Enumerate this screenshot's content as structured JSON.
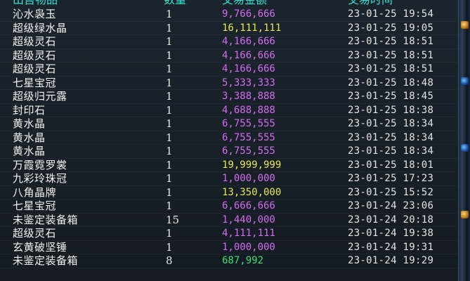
{
  "header": {
    "item": "出售物品",
    "qty": "数量",
    "amount": "交易金额",
    "time": "交易时间"
  },
  "colors": {
    "purple": "#d46cf0",
    "yellow": "#e8e84a",
    "green": "#35e07a",
    "header": "#35e0cf"
  },
  "rows": [
    {
      "item": "沁水袅玉",
      "qty": "1",
      "amount": "9,766,666",
      "color": "purple",
      "time": "23-01-25 19:54"
    },
    {
      "item": "超级绿水晶",
      "qty": "1",
      "amount": "16,111,111",
      "color": "yellow",
      "time": "23-01-25 19:05"
    },
    {
      "item": "超级灵石",
      "qty": "1",
      "amount": "4,166,666",
      "color": "purple",
      "time": "23-01-25 18:51"
    },
    {
      "item": "超级灵石",
      "qty": "1",
      "amount": "4,166,666",
      "color": "purple",
      "time": "23-01-25 18:51"
    },
    {
      "item": "超级灵石",
      "qty": "1",
      "amount": "4,166,666",
      "color": "purple",
      "time": "23-01-25 18:51"
    },
    {
      "item": "七星宝冠",
      "qty": "1",
      "amount": "5,333,333",
      "color": "purple",
      "time": "23-01-25 18:48"
    },
    {
      "item": "超级归元露",
      "qty": "1",
      "amount": "3,388,888",
      "color": "purple",
      "time": "23-01-25 18:45"
    },
    {
      "item": "封印石",
      "qty": "1",
      "amount": "4,688,888",
      "color": "purple",
      "time": "23-01-25 18:38"
    },
    {
      "item": "黄水晶",
      "qty": "1",
      "amount": "6,755,555",
      "color": "purple",
      "time": "23-01-25 18:34"
    },
    {
      "item": "黄水晶",
      "qty": "1",
      "amount": "6,755,555",
      "color": "purple",
      "time": "23-01-25 18:34"
    },
    {
      "item": "黄水晶",
      "qty": "1",
      "amount": "6,755,555",
      "color": "purple",
      "time": "23-01-25 18:34"
    },
    {
      "item": "万霞霓罗裳",
      "qty": "1",
      "amount": "19,999,999",
      "color": "yellow",
      "time": "23-01-25 18:01"
    },
    {
      "item": "九彩玲珠冠",
      "qty": "1",
      "amount": "1,000,000",
      "color": "purple",
      "time": "23-01-25 17:23"
    },
    {
      "item": "八角晶牌",
      "qty": "1",
      "amount": "13,350,000",
      "color": "yellow",
      "time": "23-01-25 15:52"
    },
    {
      "item": "七星宝冠",
      "qty": "1",
      "amount": "6,666,666",
      "color": "purple",
      "time": "23-01-24 23:06"
    },
    {
      "item": "未鉴定装备箱",
      "qty": "15",
      "amount": "1,440,000",
      "color": "purple",
      "time": "23-01-24 20:18"
    },
    {
      "item": "超级灵石",
      "qty": "1",
      "amount": "4,111,111",
      "color": "purple",
      "time": "23-01-24 19:38"
    },
    {
      "item": "玄黄破坚锤",
      "qty": "1",
      "amount": "1,000,000",
      "color": "purple",
      "time": "23-01-24 19:31"
    },
    {
      "item": "未鉴定装备箱",
      "qty": "8",
      "amount": "687,992",
      "color": "green",
      "time": "23-01-24 19:29"
    }
  ]
}
